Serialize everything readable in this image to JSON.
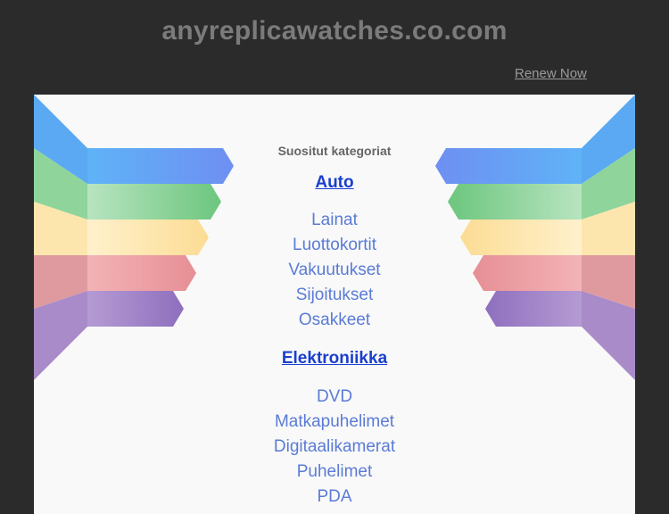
{
  "header": {
    "domain": "anyreplicawatches.co.com",
    "renew_label": "Renew Now"
  },
  "main": {
    "heading": "Suositut kategoriat",
    "groups": [
      {
        "title": "Auto",
        "links": [
          "Lainat",
          "Luottokortit",
          "Vakuutukset",
          "Sijoitukset",
          "Osakkeet"
        ]
      },
      {
        "title": "Elektroniikka",
        "links": [
          "DVD",
          "Matkapuhelimet",
          "Digitaalikamerat",
          "Puhelimet",
          "PDA"
        ]
      }
    ]
  },
  "colors": {
    "background": "#2b2b2b",
    "panel": "#f9f9f9",
    "group_title": "#1a3fcf",
    "link": "#5a7bd6",
    "ribbon_blue": "#6aa8f5",
    "ribbon_green": "#7ccf8d",
    "ribbon_yellow": "#fbe3a6",
    "ribbon_pink": "#e39b9f",
    "ribbon_purple": "#9b7fc2"
  }
}
